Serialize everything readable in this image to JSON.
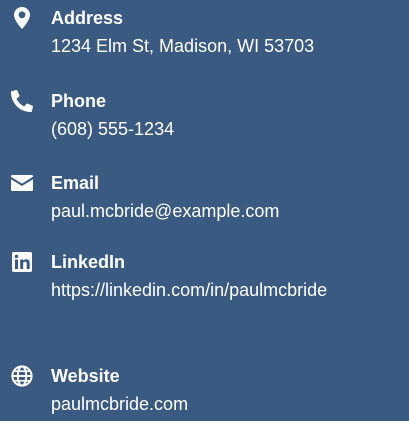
{
  "theme": {
    "background": "#3a5a82",
    "text": "#ffffff"
  },
  "contact": {
    "items": [
      {
        "icon": "map-marker-icon",
        "label": "Address",
        "value": "1234 Elm St, Madison, WI 53703"
      },
      {
        "icon": "phone-icon",
        "label": "Phone",
        "value": "(608) 555-1234"
      },
      {
        "icon": "envelope-icon",
        "label": "Email",
        "value": "paul.mcbride@example.com"
      },
      {
        "icon": "linkedin-icon",
        "label": "LinkedIn",
        "value": "https://linkedin.com/in/paulmcbride"
      },
      {
        "icon": "globe-icon",
        "label": "Website",
        "value": "paulmcbride.com"
      }
    ]
  }
}
